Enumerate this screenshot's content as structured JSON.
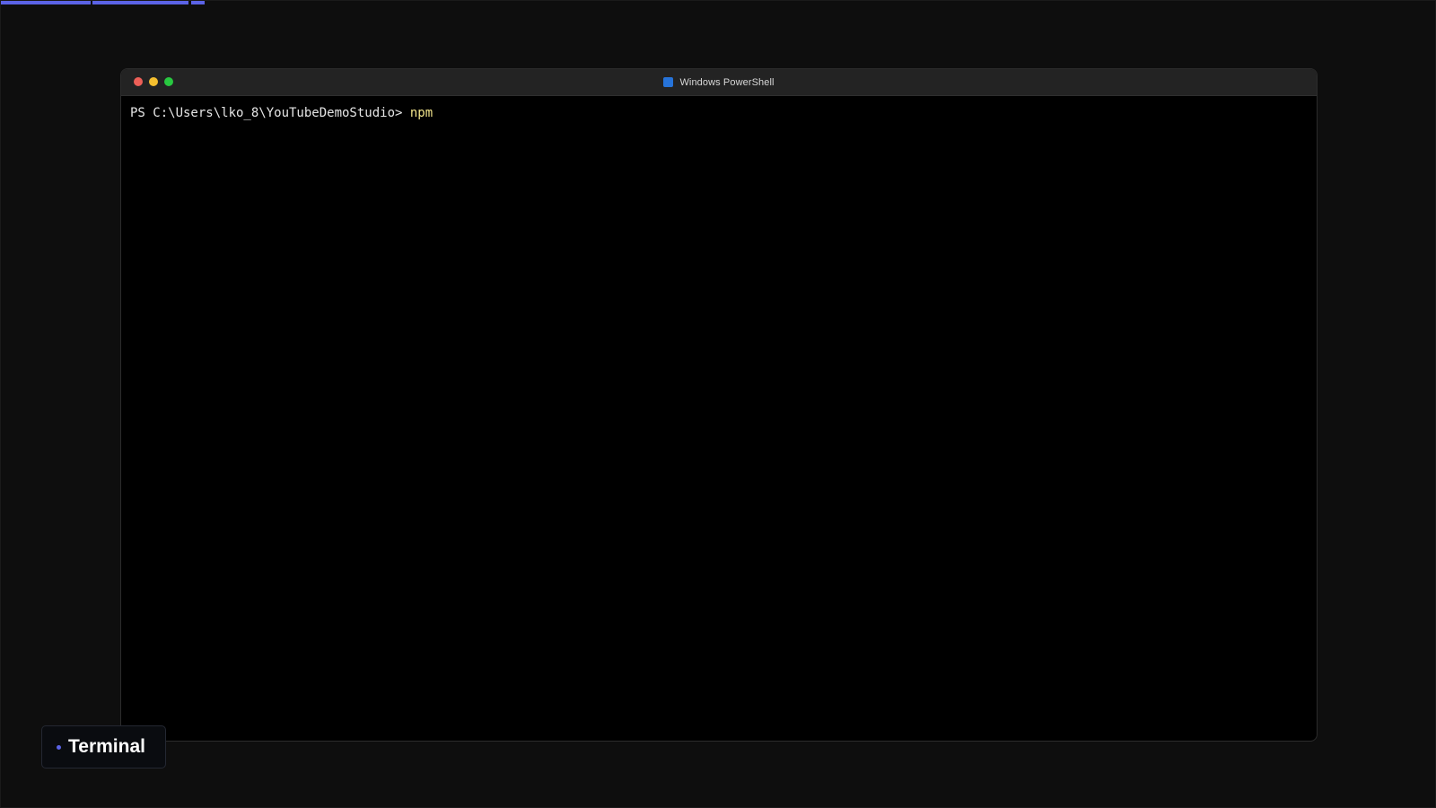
{
  "colors": {
    "progress": "#5b63e6",
    "close": "#ed5f57",
    "minimize": "#f5bf2f",
    "maximize": "#28c840",
    "powershell_icon": "#2673d9",
    "command": "#f4e68c",
    "badge_dot": "#5b63e6"
  },
  "window": {
    "title": "Windows PowerShell",
    "icon": "powershell-icon"
  },
  "terminal": {
    "prompt": "PS C:\\Users\\lko_8\\YouTubeDemoStudio> ",
    "command": "npm"
  },
  "badge": {
    "label": "Terminal"
  }
}
